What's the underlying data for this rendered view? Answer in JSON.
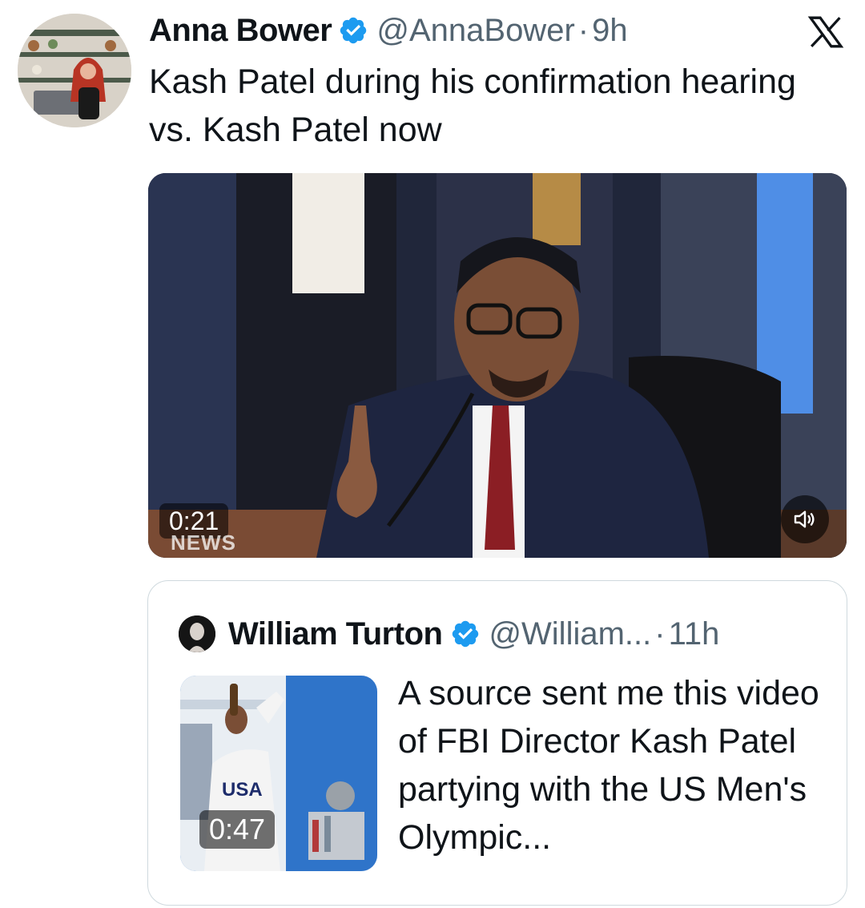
{
  "tweet": {
    "author_name": "Anna Bower",
    "handle": "@AnnaBower",
    "separator": "·",
    "time": "9h",
    "text": "Kash Patel during his confirmation hearing vs. Kash Patel now",
    "video": {
      "duration": "0:21",
      "watermark": "NEWS",
      "mute_icon": "speaker-icon"
    }
  },
  "quoted_tweet": {
    "author_name": "William Turton",
    "handle": "@William...",
    "separator": "·",
    "time": "11h",
    "text": "A source sent me this video of FBI Director Kash Patel partying with the US Men's Olympic...",
    "video": {
      "duration": "0:47"
    }
  },
  "colors": {
    "verified": "#1d9bf0",
    "secondary_text": "#536471",
    "border": "#cfd9de"
  },
  "icons": {
    "verified": "verified-badge-icon",
    "brand": "x-logo-icon",
    "mute": "speaker-icon"
  }
}
